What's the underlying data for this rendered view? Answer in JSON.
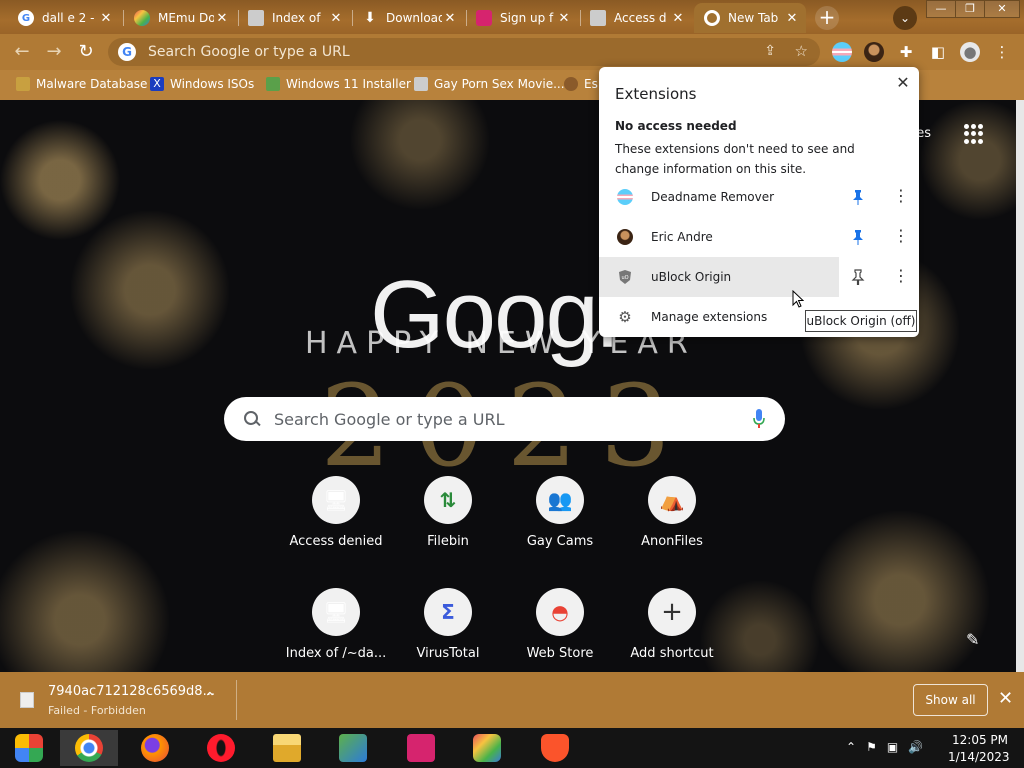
{
  "tabs": [
    {
      "label": "dall e 2 -",
      "icon": "google-icon",
      "color": "#ffffff"
    },
    {
      "label": "MEmu Do",
      "icon": "memu-icon",
      "color": "#6ab04c"
    },
    {
      "label": "Index of",
      "icon": "computer-icon",
      "color": "#dddddd"
    },
    {
      "label": "Download",
      "icon": "download-icon",
      "color": "#ffffff"
    },
    {
      "label": "Sign up f",
      "icon": "brand-icon",
      "color": "#d6246e"
    },
    {
      "label": "Access d",
      "icon": "computer-icon",
      "color": "#dddddd"
    },
    {
      "label": "New Tab",
      "icon": "chrome-icon",
      "color": "#ffffff"
    }
  ],
  "window": {
    "minimize": "—",
    "restore": "❐",
    "close": "✕"
  },
  "toolbar": {
    "back": "←",
    "forward": "→",
    "reload": "↻",
    "omnibox_placeholder": "Search Google or type a URL"
  },
  "bookmarks": [
    {
      "label": "Malware Database",
      "color": "#c8a040"
    },
    {
      "label": "Windows ISOs",
      "color": "#1a3cbf"
    },
    {
      "label": "Windows 11 Installer",
      "color": "#5aa04a"
    },
    {
      "label": "Gay Porn Sex Movie...",
      "color": "#cccccc"
    },
    {
      "label": "Es",
      "color": "#8a5a2a"
    }
  ],
  "ntp": {
    "images_link": "ges",
    "doodle_word": "Googl",
    "doodle_line": "HAPPY NEW YEAR",
    "doodle_year": "2023",
    "search_placeholder": "Search Google or type a URL"
  },
  "shortcuts": [
    {
      "label": "Access denied",
      "glyph": "🖥"
    },
    {
      "label": "Filebin",
      "glyph": "⇅"
    },
    {
      "label": "Gay Cams",
      "glyph": "👥"
    },
    {
      "label": "AnonFiles",
      "glyph": "⛺"
    },
    {
      "label": "Index of /~da...",
      "glyph": "🖥"
    },
    {
      "label": "VirusTotal",
      "glyph": "Σ"
    },
    {
      "label": "Web Store",
      "glyph": "◓"
    },
    {
      "label": "Add shortcut",
      "glyph": "+"
    }
  ],
  "extensions": {
    "title": "Extensions",
    "section": "No access needed",
    "description": "These extensions don't need to see and change information on this site.",
    "items": [
      {
        "name": "Deadname Remover",
        "pinned": true
      },
      {
        "name": "Eric Andre",
        "pinned": true
      },
      {
        "name": "uBlock Origin",
        "pinned": false
      }
    ],
    "manage": "Manage extensions",
    "tooltip": "uBlock Origin (off)"
  },
  "download": {
    "filename": "7940ac712128c6569d8...",
    "status": "Failed - Forbidden",
    "show_all": "Show all"
  },
  "taskbar": {
    "apps": [
      "Start",
      "Chrome",
      "Firefox",
      "Opera",
      "File Explorer",
      "Network",
      "Brand",
      "MEmu",
      "Brave"
    ],
    "time": "12:05 PM",
    "date": "1/14/2023"
  }
}
